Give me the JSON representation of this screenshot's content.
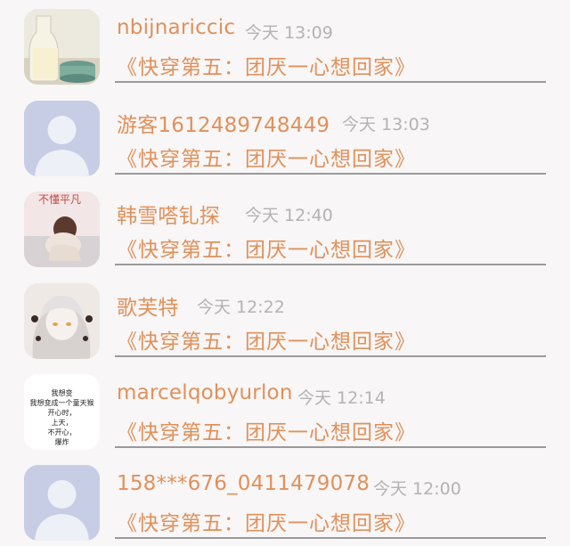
{
  "comments": [
    {
      "user": "nbijnariccic",
      "time": "今天 13:09",
      "book": "《快穿第五：团厌一心想回家》",
      "avatar": "photo-milk-bottle-icon"
    },
    {
      "user": "游客1612489748449",
      "time": "今天 13:03",
      "book": "《快穿第五：团厌一心想回家》",
      "avatar": "default-user-icon"
    },
    {
      "user": "韩雪嗒钆探",
      "time": "今天 12:40",
      "book": "《快穿第五：团厌一心想回家》",
      "avatar": "photo-girl-icon",
      "avatar_text": "不懂平凡"
    },
    {
      "user": "歌芙特",
      "time": "今天 12:22",
      "book": "《快穿第五：团厌一心想回家》",
      "avatar": "anime-girl-icon"
    },
    {
      "user": "marcelqobyurlon",
      "time": "今天 12:14",
      "book": "《快穿第五：团厌一心想回家》",
      "avatar": "text-note-icon",
      "avatar_text": [
        "我想变",
        "我想变成一个童天猴",
        "开心时，",
        "上天，",
        "不开心，",
        "爆炸"
      ]
    },
    {
      "user": "158***676_0411479078",
      "time": "今天 12:00",
      "book": "《快穿第五：团厌一心想回家》",
      "avatar": "default-user-icon"
    }
  ],
  "colors": {
    "accent": "#e0915a",
    "time": "#b3b3b3",
    "divider": "#9a9a9a",
    "avatar_default": "#c6cde4"
  }
}
